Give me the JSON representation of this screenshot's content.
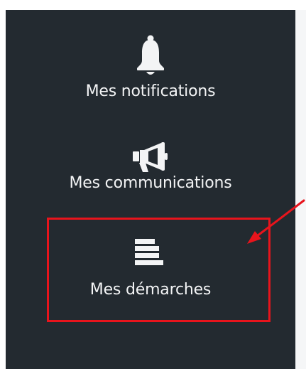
{
  "sidebar": {
    "background": "#232a30",
    "items": [
      {
        "label": "Mes notifications",
        "icon": "bell-icon"
      },
      {
        "label": "Mes communications",
        "icon": "megaphone-icon"
      },
      {
        "label": "Mes démarches",
        "icon": "list-bars-icon"
      }
    ]
  },
  "annotation": {
    "highlighted_item": "Mes démarches",
    "box_color": "#e8141c",
    "arrow_color": "#e8141c"
  }
}
